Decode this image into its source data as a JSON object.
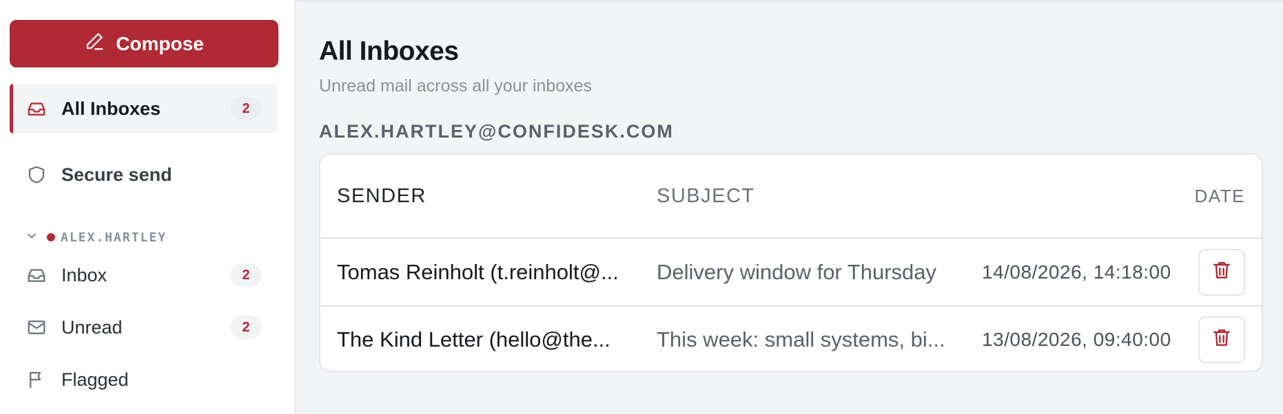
{
  "sidebar": {
    "compose_label": "Compose",
    "all_inboxes": {
      "label": "All Inboxes",
      "count": "2"
    },
    "secure_send": {
      "label": "Secure send"
    },
    "account": {
      "name": "ALEX.HARTLEY",
      "items": [
        {
          "label": "Inbox",
          "count": "2"
        },
        {
          "label": "Unread",
          "count": "2"
        },
        {
          "label": "Flagged"
        }
      ]
    }
  },
  "main": {
    "title": "All Inboxes",
    "subtitle": "Unread mail across all your inboxes",
    "account_email": "ALEX.HARTLEY@CONFIDESK.COM",
    "columns": {
      "sender": "SENDER",
      "subject": "SUBJECT",
      "date": "DATE"
    },
    "rows": [
      {
        "sender": "Tomas Reinholt (t.reinholt@...",
        "subject": "Delivery window for Thursday",
        "date": "14/08/2026, 14:18:00"
      },
      {
        "sender": "The Kind Letter (hello@the...",
        "subject": "This week: small systems, bi...",
        "date": "13/08/2026, 09:40:00"
      }
    ]
  },
  "colors": {
    "accent": "#b02a35",
    "background": "#f3f4f6"
  },
  "icons": {
    "compose": "pencil-icon",
    "all_inboxes": "inbox-tray-icon",
    "secure_send": "shield-icon",
    "account_toggle": "chevron-down-icon",
    "inbox": "inbox-tray-icon",
    "unread": "envelope-icon",
    "flagged": "flag-icon",
    "delete": "trash-icon"
  }
}
